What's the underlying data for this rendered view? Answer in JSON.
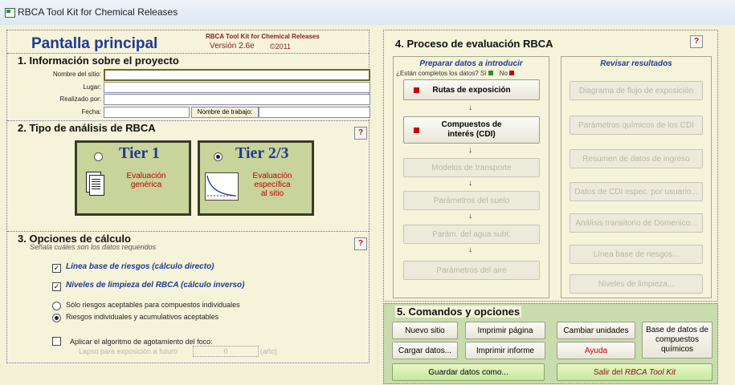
{
  "window": {
    "title": "RBCA Tool Kit for Chemical Releases"
  },
  "header": {
    "screen_title": "Pantalla principal",
    "product_name": "RBCA Tool Kit for Chemical Releases",
    "version": "Versión 2.6e",
    "year": "©2011"
  },
  "project": {
    "title": "1. Información sobre el proyecto",
    "site_name_label": "Nombre del sitio:",
    "place_label": "Lugar:",
    "done_by_label": "Realizado por:",
    "date_label": "Fecha:",
    "job_name_label": "Nombre de trabajo:",
    "site_name_value": "",
    "place_value": "",
    "done_by_value": "",
    "date_value": "",
    "job_name_value": ""
  },
  "analysis": {
    "title": "2. Tipo de análisis de RBCA",
    "help": "?",
    "tier1": {
      "label": "Tier 1",
      "desc1": "Evaluación",
      "desc2": "genérica"
    },
    "tier23": {
      "label": "Tier 2/3",
      "desc1": "Evaluación",
      "desc2": "específica",
      "desc3": "al sitio"
    }
  },
  "calc": {
    "title": "3. Opciones de cálculo",
    "subtitle": "Señala cuáles son los datos requeridos",
    "help": "?",
    "opt_baseline": "Línea base de riesgos (cálculo directo)",
    "opt_cleanup": "Niveles de limpieza del RBCA (cálculo inverso)",
    "radio_individual": "Sólo riesgos aceptables para compuestos individuales",
    "radio_cumulative": "Riesgos individuales y acumulativos aceptables",
    "depletion": "Aplicar el algoritmo de agotamiento del foco:",
    "future_label": "Lapso para exposición a futuro",
    "future_value": "0",
    "future_unit": "(año)"
  },
  "process": {
    "title": "4. Proceso de evaluación RBCA",
    "help": "?",
    "prepare_title": "Preparar datos a introducir",
    "complete_q": "¿Están completos los datos?",
    "yes": "Sí",
    "no": "No",
    "review_title": "Revisar resultados",
    "prepare_buttons": [
      "Rutas de exposición",
      "Compuestos de interés (CDI)",
      "Modelos de transporte",
      "Parámetros del suelo",
      "Parám. del agua subt.",
      "Parámetros del aire"
    ],
    "review_buttons": [
      "Diagrama de flujo de exposición",
      "Parámetros químicos de los CDI",
      "Resumen de datos de ingreso",
      "Datos de CDI espec. por usuario...",
      "Análisis transitorio de Domenico...",
      "Línea base de riesgos...",
      "Niveles de limpieza..."
    ]
  },
  "commands": {
    "title": "5. Comandos y opciones",
    "new_site": "Nuevo sitio",
    "print_page": "Imprimir página",
    "change_units": "Cambiar unidades",
    "database": "Base de datos de compuestos químicos",
    "load_data": "Cargar datos...",
    "print_report": "Imprimir informe",
    "help": "Ayuda",
    "save_as": "Guardar datos como...",
    "exit_prefix": "Salir del",
    "exit_name": "RBCA Tool Kit"
  },
  "colors": {
    "accent_red": "#c00000",
    "status_yes": "#2e8b2e",
    "status_no": "#cc0000",
    "title_blue": "#1f3a93"
  }
}
